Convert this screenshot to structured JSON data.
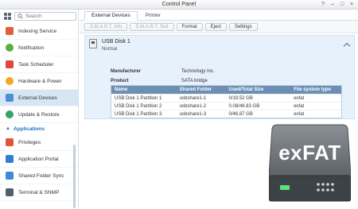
{
  "window": {
    "title": "Control Panel",
    "help": "?",
    "minimize": "–",
    "maximize": "□",
    "close": "×"
  },
  "sidebar": {
    "search_placeholder": "Search",
    "items": [
      {
        "label": "Indexing Service",
        "icon": "indexing-icon",
        "color": "#e35d3a"
      },
      {
        "label": "Notification",
        "icon": "notification-icon",
        "color": "#57b13c"
      },
      {
        "label": "Task Scheduler",
        "icon": "task-scheduler-icon",
        "color": "#e2483a"
      },
      {
        "label": "Hardware & Power",
        "icon": "hardware-power-icon",
        "color": "#f3a623"
      },
      {
        "label": "External Devices",
        "icon": "external-devices-icon",
        "color": "#4a8fd6",
        "active": true
      },
      {
        "label": "Update & Restore",
        "icon": "update-restore-icon",
        "color": "#3aa06a"
      }
    ],
    "section_label": "Applications",
    "app_items": [
      {
        "label": "Privileges",
        "icon": "privileges-icon",
        "color": "#e0553c"
      },
      {
        "label": "Application Portal",
        "icon": "application-portal-icon",
        "color": "#2f7ed3"
      },
      {
        "label": "Shared Folder Sync",
        "icon": "shared-folder-sync-icon",
        "color": "#3d8bd6"
      },
      {
        "label": "Terminal & SNMP",
        "icon": "terminal-snmp-icon",
        "color": "#50606f"
      }
    ]
  },
  "tabs": [
    {
      "label": "External Devices",
      "active": true
    },
    {
      "label": "Printer",
      "active": false
    }
  ],
  "toolbar": {
    "smart_info": "S.M.A.R.T. Info",
    "smart_test": "S.M.A.R.T. Test",
    "format": "Format",
    "eject": "Eject",
    "settings": "Settings"
  },
  "disk": {
    "name": "USB Disk 1",
    "status": "Normal",
    "manufacturer_label": "Manufacturer",
    "manufacturer": "Technology Inc.",
    "product_label": "Product",
    "product": "SATA bridge"
  },
  "partitions": {
    "headers": [
      "Name",
      "Shared Folder",
      "Used/Total Size",
      "File system type"
    ],
    "rows": [
      [
        "USB Disk 1 Partition 1",
        "usbshare1-1",
        "0/19.52 GB",
        "exfat"
      ],
      [
        "USB Disk 1 Partition 2",
        "usbshare1-2",
        "0.08/48.83 GB",
        "exfat"
      ],
      [
        "USB Disk 1 Partition 3",
        "usbshare1-3",
        "0/46.87 GB",
        "exfat"
      ]
    ]
  },
  "artwork": {
    "label": "exFAT"
  }
}
